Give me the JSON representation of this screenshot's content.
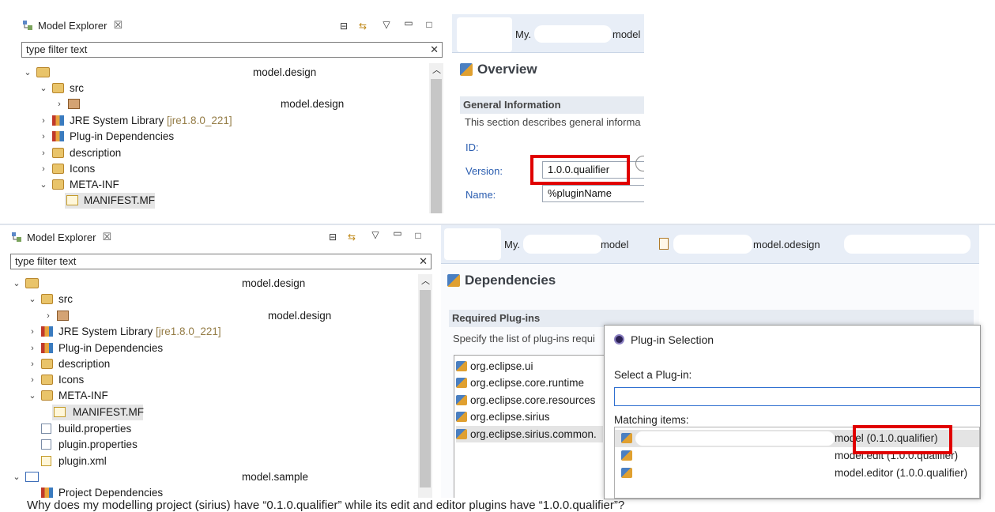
{
  "top": {
    "explorer": {
      "title": "Model Explorer",
      "filter_placeholder": "type filter text",
      "tree": [
        {
          "label": "model.design",
          "decoration": ""
        },
        {
          "label": "src",
          "decoration": ""
        },
        {
          "label": "model.design",
          "decoration": ""
        },
        {
          "label": "JRE System Library",
          "decoration": "[jre1.8.0_221]"
        },
        {
          "label": "Plug-in Dependencies",
          "decoration": ""
        },
        {
          "label": "description",
          "decoration": ""
        },
        {
          "label": "Icons",
          "decoration": ""
        },
        {
          "label": "META-INF",
          "decoration": ""
        },
        {
          "label": "MANIFEST.MF",
          "decoration": ""
        }
      ]
    },
    "editor": {
      "tab_label_prefix": "My.",
      "tab_label_suffix": "model",
      "heading": "Overview",
      "section_title": "General Information",
      "section_desc": "This section describes general informa",
      "id_label": "ID:",
      "version_label": "Version:",
      "version_value": "1.0.0.qualifier",
      "name_label": "Name:",
      "name_value": "%pluginName"
    }
  },
  "bottom": {
    "explorer": {
      "title": "Model Explorer",
      "filter_placeholder": "type filter text",
      "tree": [
        {
          "label": "model.design",
          "decoration": ""
        },
        {
          "label": "src",
          "decoration": ""
        },
        {
          "label": "model.design",
          "decoration": ""
        },
        {
          "label": "JRE System Library",
          "decoration": "[jre1.8.0_221]"
        },
        {
          "label": "Plug-in Dependencies",
          "decoration": ""
        },
        {
          "label": "description",
          "decoration": ""
        },
        {
          "label": "Icons",
          "decoration": ""
        },
        {
          "label": "META-INF",
          "decoration": ""
        },
        {
          "label": "MANIFEST.MF",
          "decoration": ""
        },
        {
          "label": "build.properties",
          "decoration": ""
        },
        {
          "label": "plugin.properties",
          "decoration": ""
        },
        {
          "label": "plugin.xml",
          "decoration": ""
        },
        {
          "label": "model.sample",
          "decoration": ""
        },
        {
          "label": "Project Dependencies",
          "decoration": ""
        }
      ]
    },
    "editor": {
      "tab1_prefix": "My.",
      "tab1_suffix": "model",
      "tab2_label": "model.odesign",
      "heading": "Dependencies",
      "section_title": "Required Plug-ins",
      "section_desc": "Specify the list of plug-ins requi",
      "plugins": [
        "org.eclipse.ui",
        "org.eclipse.core.runtime",
        "org.eclipse.core.resources",
        "org.eclipse.sirius",
        "org.eclipse.sirius.common."
      ]
    },
    "dialog": {
      "title": "Plug-in Selection",
      "select_label": "Select a Plug-in:",
      "matching_label": "Matching items:",
      "items": [
        "model (0.1.0.qualifier)",
        "model.edit (1.0.0.qualifier)",
        "model.editor (1.0.0.qualifier)"
      ]
    }
  },
  "caption": "Why does my modelling project (sirius) have “0.1.0.qualifier” while its edit and editor plugins have “1.0.0.qualifier”?"
}
